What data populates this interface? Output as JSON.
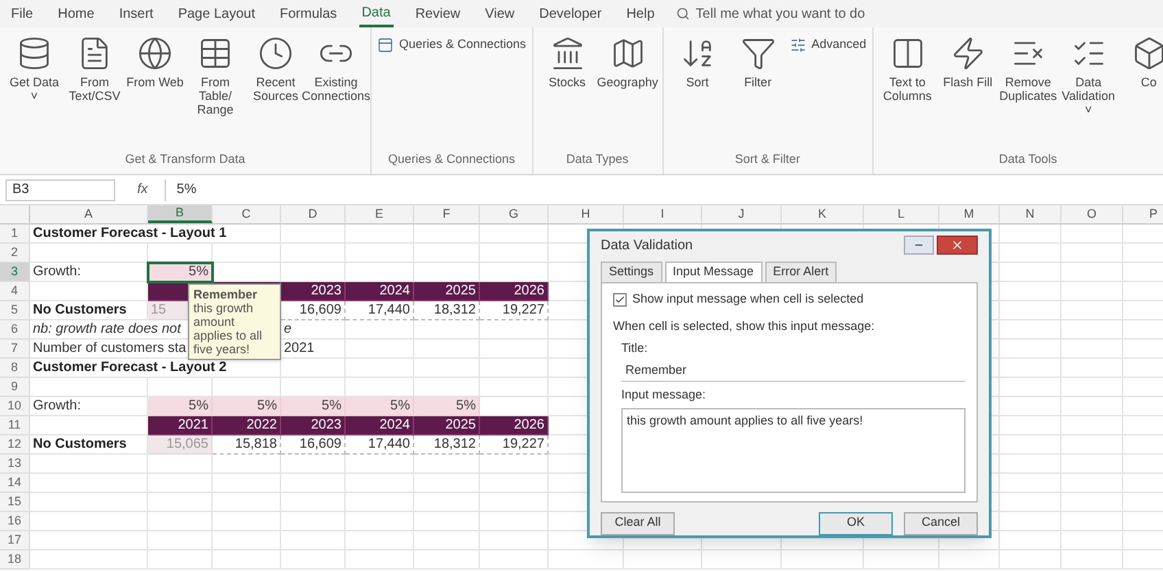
{
  "menu_tabs": [
    {
      "label": "File",
      "selected": false
    },
    {
      "label": "Home",
      "selected": false
    },
    {
      "label": "Insert",
      "selected": false
    },
    {
      "label": "Page Layout",
      "selected": false
    },
    {
      "label": "Formulas",
      "selected": false
    },
    {
      "label": "Data",
      "selected": true
    },
    {
      "label": "Review",
      "selected": false
    },
    {
      "label": "View",
      "selected": false
    },
    {
      "label": "Developer",
      "selected": false
    },
    {
      "label": "Help",
      "selected": false
    }
  ],
  "tell_me": {
    "placeholder": "Tell me what you want to do"
  },
  "ribbon": [
    {
      "label": "Get & Transform Data",
      "buttons": [
        {
          "label": "Get Data ˅",
          "kind": "database"
        },
        {
          "label": "From Text/CSV",
          "kind": "file"
        },
        {
          "label": "From Web",
          "kind": "globe"
        },
        {
          "label": "From Table/ Range",
          "kind": "table"
        },
        {
          "label": "Recent Sources",
          "kind": "clock"
        },
        {
          "label": "Existing Connections",
          "kind": "link"
        }
      ]
    },
    {
      "label": "Queries & Connections",
      "small_buttons": [
        {
          "label": "Queries & Connections",
          "kind": "panel"
        }
      ]
    },
    {
      "label": "Data Types",
      "buttons": [
        {
          "label": "Stocks",
          "kind": "bank"
        },
        {
          "label": "Geography",
          "kind": "map"
        }
      ]
    },
    {
      "label": "Sort & Filter",
      "buttons": [
        {
          "label": "Sort",
          "kind": "sort"
        },
        {
          "label": "Filter",
          "kind": "filter"
        }
      ],
      "small_buttons": [
        {
          "label": "Advanced",
          "kind": "advanced"
        }
      ]
    },
    {
      "label": "Data Tools",
      "buttons": [
        {
          "label": "Text to Columns",
          "kind": "columns"
        },
        {
          "label": "Flash Fill",
          "kind": "flash"
        },
        {
          "label": "Remove Duplicates",
          "kind": "remove"
        },
        {
          "label": "Data Validation ˅",
          "kind": "validate"
        },
        {
          "label": "Co",
          "kind": "cut"
        }
      ]
    }
  ],
  "formula_bar": {
    "name_box": "B3",
    "fx": "fx",
    "value": "5%"
  },
  "columns": [
    {
      "label": "A",
      "selected": false
    },
    {
      "label": "B",
      "selected": true
    },
    {
      "label": "C",
      "selected": false
    },
    {
      "label": "D",
      "selected": false
    },
    {
      "label": "E",
      "selected": false
    },
    {
      "label": "F",
      "selected": false
    },
    {
      "label": "G",
      "selected": false
    },
    {
      "label": "H",
      "selected": false
    },
    {
      "label": "I",
      "selected": false
    },
    {
      "label": "J",
      "selected": false
    },
    {
      "label": "K",
      "selected": false
    },
    {
      "label": "L",
      "selected": false
    },
    {
      "label": "M",
      "selected": false
    },
    {
      "label": "N",
      "selected": false
    },
    {
      "label": "O",
      "selected": false
    },
    {
      "label": "P",
      "selected": false
    }
  ],
  "rows": [
    {
      "number": "1",
      "selected": false,
      "cells": [
        {
          "text": "Customer Forecast - Layout 1",
          "kind": "title",
          "selected": false
        },
        {
          "kind": "empty"
        },
        {
          "kind": "empty"
        },
        {
          "kind": "empty"
        },
        {
          "kind": "empty"
        },
        {
          "kind": "empty"
        },
        {
          "kind": "empty"
        }
      ]
    },
    {
      "number": "2",
      "selected": false,
      "cells": []
    },
    {
      "number": "3",
      "selected": true,
      "cells": [
        {
          "text": "Growth:",
          "kind": "label",
          "selected": false
        },
        {
          "text": "5%",
          "kind": "pct",
          "selected": true
        },
        {
          "kind": "empty"
        },
        {
          "kind": "empty"
        },
        {
          "kind": "empty"
        },
        {
          "kind": "empty"
        },
        {
          "kind": "empty"
        }
      ]
    },
    {
      "number": "4",
      "selected": false,
      "cells": [
        {
          "kind": "empty"
        },
        {
          "kind": "year",
          "selected": false
        },
        {
          "kind": "year"
        },
        {
          "text": "2023",
          "kind": "year",
          "selected": false
        },
        {
          "text": "2024",
          "kind": "year",
          "selected": false
        },
        {
          "text": "2025",
          "kind": "year",
          "selected": false
        },
        {
          "text": "2026",
          "kind": "year",
          "selected": false
        }
      ]
    },
    {
      "number": "5",
      "selected": false,
      "cells": [
        {
          "text": "No Customers",
          "kind": "bold",
          "selected": false
        },
        {
          "text": "15",
          "kind": "partial",
          "selected": false
        },
        {
          "kind": "empty"
        },
        {
          "text": "16,609",
          "kind": "num",
          "selected": false
        },
        {
          "text": "17,440",
          "kind": "num",
          "selected": false
        },
        {
          "text": "18,312",
          "kind": "num",
          "selected": false
        },
        {
          "text": "19,227",
          "kind": "num",
          "selected": false
        }
      ]
    },
    {
      "number": "6",
      "selected": false,
      "cells": [
        {
          "text": "nb: growth rate does not",
          "kind": "italic",
          "selected": false
        },
        {
          "kind": "empty"
        },
        {
          "kind": "empty"
        },
        {
          "text": "e",
          "kind": "italic",
          "selected": false
        },
        {
          "kind": "empty"
        },
        {
          "kind": "empty"
        },
        {
          "kind": "empty"
        }
      ]
    },
    {
      "number": "7",
      "selected": false,
      "cells": [
        {
          "text": "Number of customers sta",
          "kind": "label",
          "selected": false
        },
        {
          "kind": "empty"
        },
        {
          "kind": "empty"
        },
        {
          "text": "2021",
          "kind": "label",
          "selected": false
        },
        {
          "kind": "empty"
        },
        {
          "kind": "empty"
        },
        {
          "kind": "empty"
        }
      ]
    },
    {
      "number": "8",
      "selected": false,
      "cells": [
        {
          "text": "Customer Forecast - Layout 2",
          "kind": "title",
          "selected": false
        },
        {
          "kind": "empty"
        },
        {
          "kind": "empty"
        },
        {
          "kind": "empty"
        },
        {
          "kind": "empty"
        },
        {
          "kind": "empty"
        },
        {
          "kind": "empty"
        }
      ]
    },
    {
      "number": "9",
      "selected": false,
      "cells": []
    },
    {
      "number": "10",
      "selected": false,
      "cells": [
        {
          "text": "Growth:",
          "kind": "label",
          "selected": false
        },
        {
          "text": "5%",
          "kind": "pct",
          "selected": false
        },
        {
          "text": "5%",
          "kind": "pct",
          "selected": false
        },
        {
          "text": "5%",
          "kind": "pct",
          "selected": false
        },
        {
          "text": "5%",
          "kind": "pct",
          "selected": false
        },
        {
          "text": "5%",
          "kind": "pct",
          "selected": false
        },
        {
          "kind": "empty"
        }
      ]
    },
    {
      "number": "11",
      "selected": false,
      "cells": [
        {
          "kind": "empty"
        },
        {
          "text": "2021",
          "kind": "year",
          "selected": false
        },
        {
          "text": "2022",
          "kind": "year",
          "selected": false
        },
        {
          "text": "2023",
          "kind": "year",
          "selected": false
        },
        {
          "text": "2024",
          "kind": "year",
          "selected": false
        },
        {
          "text": "2025",
          "kind": "year",
          "selected": false
        },
        {
          "text": "2026",
          "kind": "year",
          "selected": false
        }
      ]
    },
    {
      "number": "12",
      "selected": false,
      "cells": [
        {
          "text": "No Customers",
          "kind": "bold",
          "selected": false
        },
        {
          "text": "15,065",
          "kind": "start",
          "selected": false
        },
        {
          "text": "15,818",
          "kind": "num",
          "selected": false
        },
        {
          "text": "16,609",
          "kind": "num",
          "selected": false
        },
        {
          "text": "17,440",
          "kind": "num",
          "selected": false
        },
        {
          "text": "18,312",
          "kind": "num",
          "selected": false
        },
        {
          "text": "19,227",
          "kind": "num",
          "selected": false
        }
      ]
    },
    {
      "number": "13",
      "selected": false,
      "cells": []
    },
    {
      "number": "14",
      "selected": false,
      "cells": []
    },
    {
      "number": "15",
      "selected": false,
      "cells": []
    },
    {
      "number": "16",
      "selected": false,
      "cells": []
    },
    {
      "number": "17",
      "selected": false,
      "cells": []
    },
    {
      "number": "18",
      "selected": false,
      "cells": []
    }
  ],
  "input_tooltip": {
    "title": "Remember",
    "message": "this growth amount applies to all five years!"
  },
  "dialog": {
    "title": "Data Validation",
    "tabs": [
      {
        "label": "Settings",
        "selected": false
      },
      {
        "label": "Input Message",
        "selected": true
      },
      {
        "label": "Error Alert",
        "selected": false
      }
    ],
    "show_message": {
      "label": "Show input message when cell is selected",
      "checked": true
    },
    "intro": "When cell is selected, show this input message:",
    "title_label": "Title:",
    "title_value": "Remember",
    "message_label": "Input message:",
    "message_value": "this growth amount applies to all five years!",
    "buttons": [
      {
        "label": "Clear All",
        "kind": "left"
      },
      {
        "label": "OK",
        "kind": "default"
      },
      {
        "label": "Cancel",
        "kind": "normal"
      }
    ]
  }
}
